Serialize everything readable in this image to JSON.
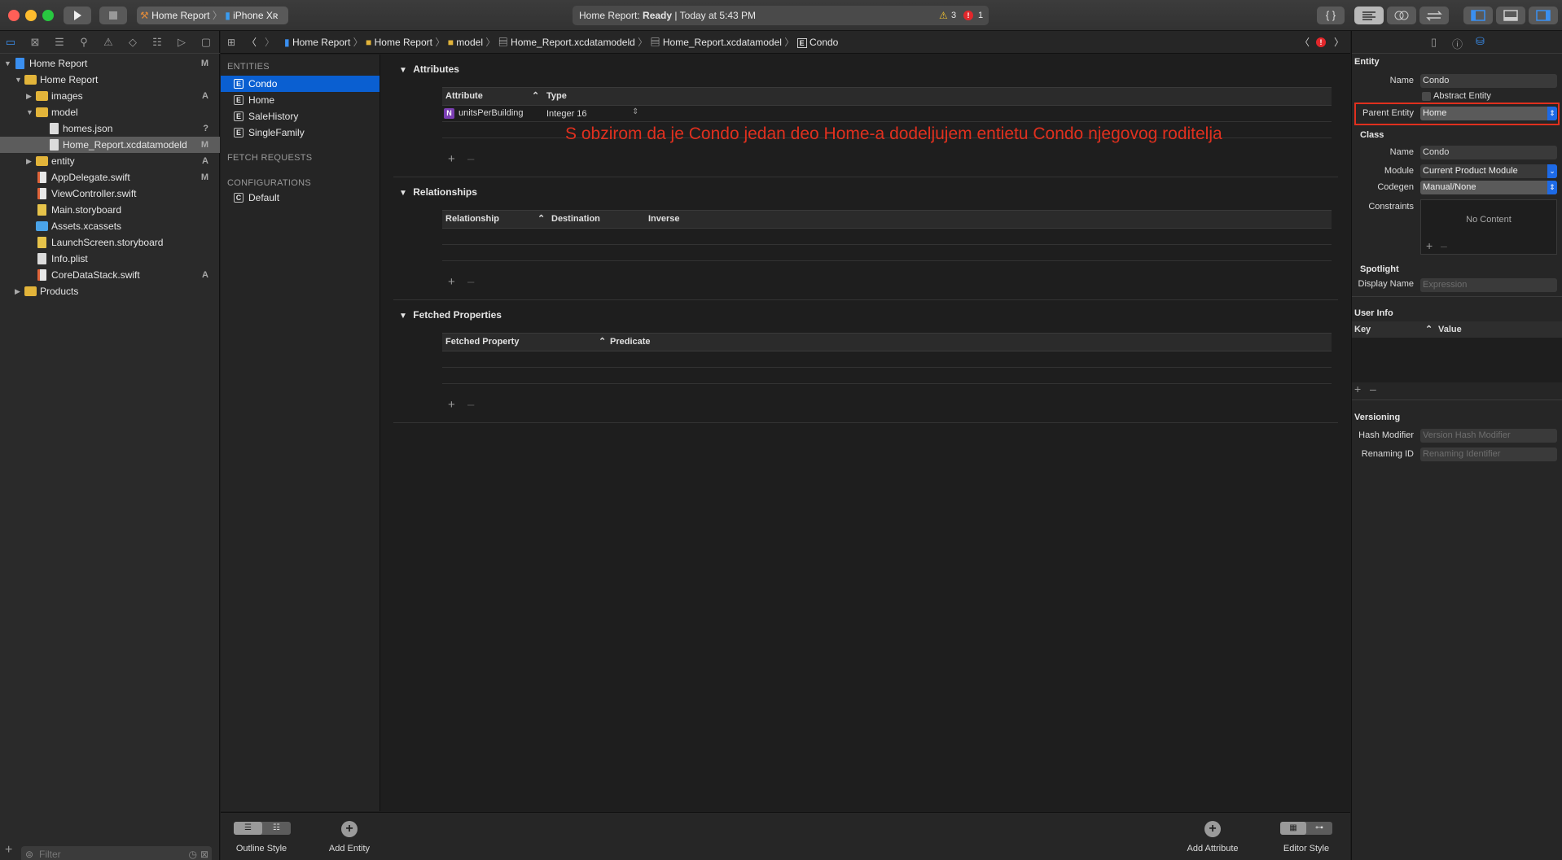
{
  "window": {
    "traffic_lights": [
      "#ff5f57",
      "#febc2e",
      "#28c840"
    ]
  },
  "toolbar": {
    "run_icon": "play-icon",
    "stop_icon": "stop-icon",
    "scheme": "Home Report",
    "device": "iPhone Xʀ",
    "status_app": "Home Report: ",
    "status_state": "Ready",
    "status_sep": " | ",
    "status_time": "Today at 5:43 PM",
    "warnings": "3",
    "errors": "1"
  },
  "navigator": {
    "filter_placeholder": "Filter",
    "items": [
      {
        "label": "Home Report",
        "badge": "M"
      },
      {
        "label": "Home Report",
        "badge": ""
      },
      {
        "label": "images",
        "badge": "A"
      },
      {
        "label": "model",
        "badge": ""
      },
      {
        "label": "homes.json",
        "badge": "?"
      },
      {
        "label": "Home_Report.xcdatamodeld",
        "badge": "M"
      },
      {
        "label": "entity",
        "badge": "A"
      },
      {
        "label": "AppDelegate.swift",
        "badge": "M"
      },
      {
        "label": "ViewController.swift",
        "badge": ""
      },
      {
        "label": "Main.storyboard",
        "badge": ""
      },
      {
        "label": "Assets.xcassets",
        "badge": ""
      },
      {
        "label": "LaunchScreen.storyboard",
        "badge": ""
      },
      {
        "label": "Info.plist",
        "badge": ""
      },
      {
        "label": "CoreDataStack.swift",
        "badge": "A"
      },
      {
        "label": "Products",
        "badge": ""
      }
    ]
  },
  "jumpbar": [
    "Home Report",
    "Home Report",
    "model",
    "Home_Report.xcdatamodeld",
    "Home_Report.xcdatamodel",
    "Condo"
  ],
  "entities": {
    "header": "ENTITIES",
    "items": [
      "Condo",
      "Home",
      "SaleHistory",
      "SingleFamily"
    ],
    "fetch_header": "FETCH REQUESTS",
    "config_header": "CONFIGURATIONS",
    "configs": [
      "Default"
    ]
  },
  "editor": {
    "attributes": {
      "title": "Attributes",
      "col1": "Attribute",
      "col2": "Type",
      "rows": [
        {
          "name": "unitsPerBuilding",
          "type": "Integer 16",
          "icon": "N"
        }
      ]
    },
    "relationships": {
      "title": "Relationships",
      "col1": "Relationship",
      "col2": "Destination",
      "col3": "Inverse"
    },
    "fetched": {
      "title": "Fetched Properties",
      "col1": "Fetched Property",
      "col2": "Predicate"
    },
    "annotation": "S obzirom da je Condo jedan deo Home-a dodeljujem entietu Condo njegovog roditelja",
    "annotation_color": "#e0301e"
  },
  "inspector": {
    "entity_title": "Entity",
    "name_label": "Name",
    "name_value": "Condo",
    "abstract_label": "Abstract Entity",
    "parent_label": "Parent Entity",
    "parent_value": "Home",
    "class_title": "Class",
    "class_name_label": "Name",
    "class_name_value": "Condo",
    "module_label": "Module",
    "module_value": "Current Product Module",
    "codegen_label": "Codegen",
    "codegen_value": "Manual/None",
    "constraints_label": "Constraints",
    "constraints_empty": "No Content",
    "spotlight_title": "Spotlight",
    "display_label": "Display Name",
    "display_placeholder": "Expression",
    "userinfo_title": "User Info",
    "key_col": "Key",
    "value_col": "Value",
    "versioning_title": "Versioning",
    "hash_label": "Hash Modifier",
    "hash_placeholder": "Version Hash Modifier",
    "renaming_label": "Renaming ID",
    "renaming_placeholder": "Renaming Identifier"
  },
  "bottom": {
    "outline": "Outline Style",
    "add_entity": "Add Entity",
    "add_attribute": "Add Attribute",
    "editor_style": "Editor Style"
  }
}
